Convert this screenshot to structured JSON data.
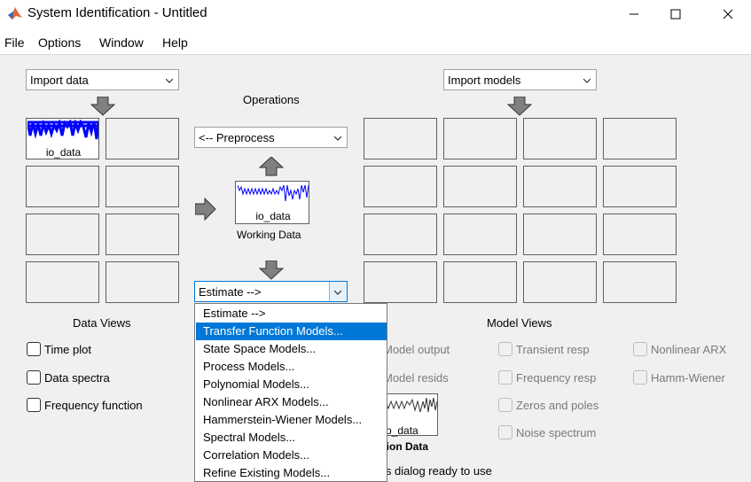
{
  "window": {
    "title": "System Identification - Untitled"
  },
  "menu": [
    "File",
    "Options",
    "Window",
    "Help"
  ],
  "import_data": {
    "value": "Import data"
  },
  "import_models": {
    "value": "Import models"
  },
  "operations": {
    "label": "Operations"
  },
  "preprocess": {
    "value": "<-- Preprocess"
  },
  "estimate": {
    "value": "Estimate -->",
    "options": [
      "Estimate -->",
      "Transfer Function Models...",
      "State Space Models...",
      "Process Models...",
      "Polynomial Models...",
      "Nonlinear ARX Models...",
      "Hammerstein-Wiener Models...",
      "Spectral Models...",
      "Correlation Models...",
      "Refine Existing Models..."
    ],
    "highlighted": "Transfer Function Models..."
  },
  "data_board": {
    "first_item": "io_data"
  },
  "working_data": {
    "item": "io_data",
    "label": "Working Data"
  },
  "validation_data": {
    "item_partial": "o_data",
    "label_partial": "ation Data"
  },
  "status": {
    "text_partial": "is dialog ready to use"
  },
  "data_views": {
    "label": "Data Views",
    "items": [
      "Time plot",
      "Data spectra",
      "Frequency function"
    ]
  },
  "model_views": {
    "label": "Model Views",
    "col1": [
      "Model output",
      "Model resids"
    ],
    "col2": [
      "Transient resp",
      "Frequency resp",
      "Zeros and poles",
      "Noise spectrum"
    ],
    "col3": [
      "Nonlinear ARX",
      "Hamm-Wiener"
    ]
  },
  "colors": {
    "accent": "#0078d7",
    "signal": "#0000ff"
  }
}
